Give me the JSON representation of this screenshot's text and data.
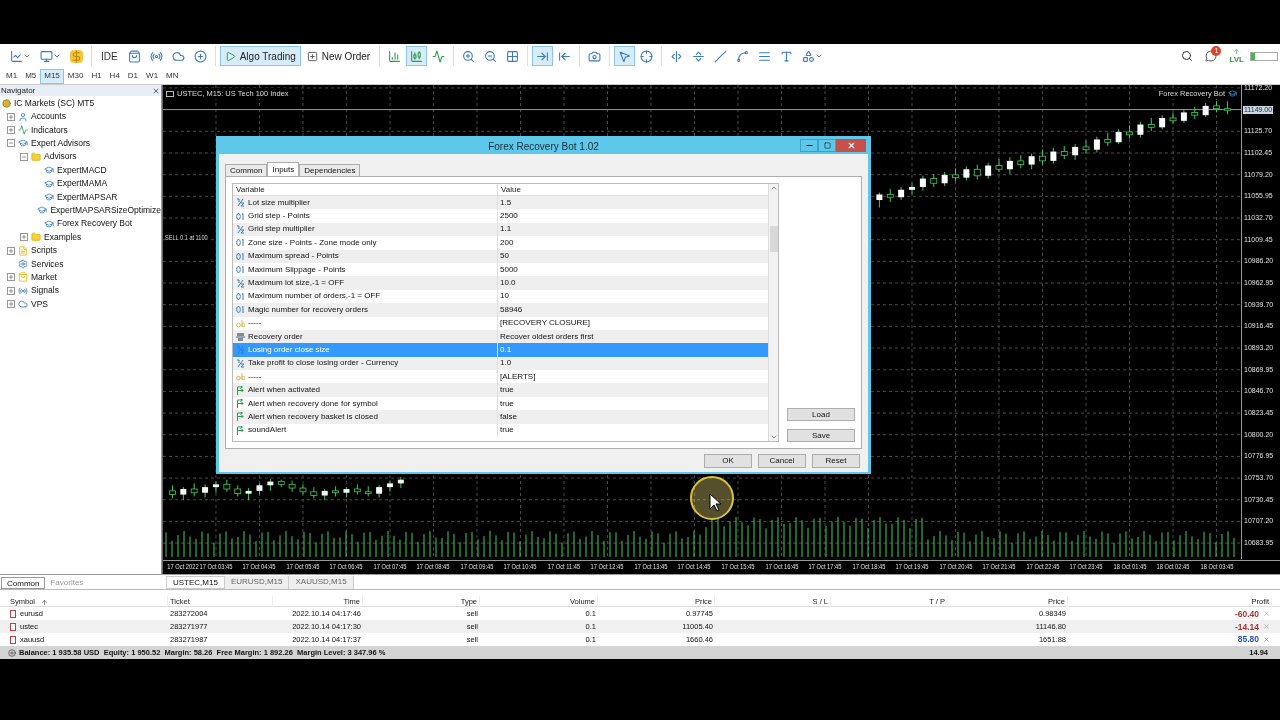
{
  "toolbar": {
    "groups": [
      [
        {
          "kind": "line-chart",
          "selected": false
        },
        {
          "kind": "chart-window",
          "selected": false
        },
        {
          "kind": "dollar",
          "selected": false
        }
      ],
      [
        {
          "kind": "ide",
          "label": "IDE",
          "selected": false
        },
        {
          "kind": "bag",
          "selected": false
        },
        {
          "kind": "signal",
          "selected": false
        },
        {
          "kind": "cloud",
          "selected": false
        },
        {
          "kind": "globe",
          "selected": false
        }
      ],
      [
        {
          "kind": "algo",
          "label": "Algo Trading",
          "selected": true
        },
        {
          "kind": "order",
          "label": "New Order",
          "selected": false
        }
      ],
      [
        {
          "kind": "bars",
          "selected": false
        },
        {
          "kind": "candles",
          "selected": true
        },
        {
          "kind": "line",
          "selected": false
        }
      ],
      [
        {
          "kind": "zoom-in",
          "selected": false
        },
        {
          "kind": "zoom-out",
          "selected": false
        },
        {
          "kind": "grid",
          "selected": false
        }
      ],
      [
        {
          "kind": "autoscroll",
          "selected": true
        },
        {
          "kind": "shift",
          "selected": false
        }
      ],
      [
        {
          "kind": "screenshot",
          "selected": false
        }
      ],
      [
        {
          "kind": "cursor",
          "selected": true
        },
        {
          "kind": "crosshair",
          "selected": false
        }
      ],
      [
        {
          "kind": "vline",
          "selected": false
        },
        {
          "kind": "hline",
          "selected": false
        },
        {
          "kind": "trendline",
          "selected": false
        },
        {
          "kind": "channel",
          "selected": false
        },
        {
          "kind": "fibo",
          "selected": false
        },
        {
          "kind": "text",
          "selected": false
        },
        {
          "kind": "shapes",
          "selected": false
        }
      ]
    ],
    "notifications": "1",
    "level_label": "LVL",
    "timeframes": [
      {
        "label": "M1",
        "selected": false
      },
      {
        "label": "M5",
        "selected": false
      },
      {
        "label": "M15",
        "selected": true
      },
      {
        "label": "M30",
        "selected": false
      },
      {
        "label": "H1",
        "selected": false
      },
      {
        "label": "H4",
        "selected": false
      },
      {
        "label": "D1",
        "selected": false
      },
      {
        "label": "W1",
        "selected": false
      },
      {
        "label": "MN",
        "selected": false
      }
    ]
  },
  "navigator": {
    "title": "Navigator",
    "root": {
      "label": "IC Markets (SC) MT5",
      "children": [
        {
          "label": "Accounts",
          "kind": "accounts",
          "expanded": false
        },
        {
          "label": "Indicators",
          "kind": "indicators",
          "expanded": false
        },
        {
          "label": "Expert Advisors",
          "kind": "experts",
          "expanded": true,
          "children": [
            {
              "label": "Advisors",
              "kind": "folder",
              "expanded": true,
              "children": [
                {
                  "label": "ExpertMACD",
                  "kind": "expert"
                },
                {
                  "label": "ExpertMAMA",
                  "kind": "expert"
                },
                {
                  "label": "ExpertMAPSAR",
                  "kind": "expert"
                },
                {
                  "label": "ExpertMAPSARSizeOptimize",
                  "kind": "expert"
                },
                {
                  "label": "Forex Recovery Bot",
                  "kind": "expert"
                }
              ]
            },
            {
              "label": "Examples",
              "kind": "folder",
              "expanded": false
            }
          ]
        },
        {
          "label": "Scripts",
          "kind": "scripts",
          "expanded": false
        },
        {
          "label": "Services",
          "kind": "services"
        },
        {
          "label": "Market",
          "kind": "market",
          "expanded": false
        },
        {
          "label": "Signals",
          "kind": "signals",
          "expanded": false
        },
        {
          "label": "VPS",
          "kind": "vps",
          "expanded": false
        }
      ]
    }
  },
  "chart": {
    "chart_data": {
      "type": "candlestick",
      "ylim": [
        10666.9,
        11175.4
      ],
      "grid": true,
      "ref_lines": [
        {
          "axis": "y",
          "value": 11149
        }
      ],
      "categories": [
        null,
        "17 Oct 2022",
        null,
        null,
        "17 Oct 03:45",
        null,
        null,
        null,
        "17 Oct 04:45",
        null,
        null,
        null,
        "17 Oct 05:45",
        null,
        null,
        null,
        "17 Oct 06:45",
        null,
        null,
        null,
        "17 Oct 07:45",
        null,
        null,
        null,
        "17 Oct 08:45",
        null,
        null,
        null,
        "17 Oct 09:45",
        null,
        null,
        null,
        "17 Oct 10:45",
        null,
        null,
        null,
        "17 Oct 11:45",
        null,
        null,
        null,
        "17 Oct 12:45",
        null,
        null,
        null,
        "17 Oct 13:45",
        null,
        null,
        null,
        "17 Oct 14:45",
        null,
        null,
        null,
        "17 Oct 15:45",
        null,
        null,
        null,
        "17 Oct 16:45",
        null,
        null,
        null,
        "17 Oct 17:45",
        null,
        null,
        null,
        "17 Oct 18:45",
        null,
        null,
        null,
        "17 Oct 19:45",
        null,
        null,
        null,
        "17 Oct 20:45",
        null,
        null,
        null,
        "17 Oct 21:45",
        null,
        null,
        null,
        "17 Oct 22:45",
        null,
        null,
        null,
        "17 Oct 23:45",
        null,
        null,
        null,
        "18 Oct 01:45",
        null,
        null,
        null,
        "18 Oct 02:45",
        null,
        null,
        null,
        "18 Oct 03:45",
        null
      ],
      "yticks": [
        {
          "value": 11172.2,
          "label": "11172.20"
        },
        {
          "value": 11125.7,
          "label": "11125.70"
        },
        {
          "value": 11102.45,
          "label": "11102.45"
        },
        {
          "value": 11079.2,
          "label": "11079.20"
        },
        {
          "value": 11055.95,
          "label": "11055.95"
        },
        {
          "value": 11032.7,
          "label": "11032.70"
        },
        {
          "value": 11009.45,
          "label": "11009.45"
        },
        {
          "value": 10986.2,
          "label": "10986.20"
        },
        {
          "value": 10962.95,
          "label": "10962.95"
        },
        {
          "value": 10939.7,
          "label": "10939.70"
        },
        {
          "value": 10916.45,
          "label": "10916.45"
        },
        {
          "value": 10893.2,
          "label": "10893.20"
        },
        {
          "value": 10869.95,
          "label": "10869.95"
        },
        {
          "value": 10846.7,
          "label": "10846.70"
        },
        {
          "value": 10823.45,
          "label": "10823.45"
        },
        {
          "value": 10800.2,
          "label": "10800.20"
        },
        {
          "value": 10776.95,
          "label": "10776.95"
        },
        {
          "value": 10753.7,
          "label": "10753.70"
        },
        {
          "value": 10730.45,
          "label": "10730.45"
        },
        {
          "value": 10707.2,
          "label": "10707.20"
        },
        {
          "value": 10683.95,
          "label": "10683.95"
        }
      ],
      "ohlc": [
        [
          10740,
          10746,
          10732,
          10736
        ],
        [
          10736,
          10744,
          10730,
          10742
        ],
        [
          10742,
          10748,
          10734,
          10738
        ],
        [
          10738,
          10747,
          10733,
          10744
        ],
        [
          10744,
          10750,
          10738,
          10747
        ],
        [
          10747,
          10752,
          10739,
          10742
        ],
        [
          10742,
          10746,
          10734,
          10737
        ],
        [
          10737,
          10743,
          10730,
          10740
        ],
        [
          10740,
          10748,
          10736,
          10746
        ],
        [
          10746,
          10753,
          10740,
          10750
        ],
        [
          10750,
          10752,
          10744,
          10747
        ],
        [
          10747,
          10751,
          10739,
          10743
        ],
        [
          10743,
          10747,
          10736,
          10739
        ],
        [
          10739,
          10744,
          10732,
          10735
        ],
        [
          10735,
          10742,
          10730,
          10740
        ],
        [
          10740,
          10745,
          10734,
          10738
        ],
        [
          10738,
          10744,
          10733,
          10742
        ],
        [
          10742,
          10747,
          10736,
          10739
        ],
        [
          10739,
          10745,
          10734,
          10737
        ],
        [
          10737,
          10746,
          10733,
          10744
        ],
        [
          10744,
          10751,
          10739,
          10748
        ],
        [
          10748,
          10755,
          10743,
          10752
        ],
        null,
        null,
        null,
        null,
        null,
        null,
        null,
        null,
        null,
        null,
        null,
        null,
        null,
        null,
        null,
        null,
        null,
        null,
        null,
        null,
        null,
        null,
        null,
        null,
        null,
        null,
        null,
        null,
        null,
        null,
        null,
        null,
        null,
        null,
        null,
        null,
        null,
        null,
        null,
        null,
        null,
        null,
        null,
        [
          11052,
          11060,
          11044,
          11058
        ],
        [
          11058,
          11064,
          11050,
          11055
        ],
        [
          11055,
          11066,
          11052,
          11063
        ],
        [
          11063,
          11070,
          11058,
          11066
        ],
        [
          11066,
          11078,
          11062,
          11075
        ],
        [
          11075,
          11080,
          11066,
          11070
        ],
        [
          11070,
          11082,
          11067,
          11079
        ],
        [
          11079,
          11086,
          11072,
          11076
        ],
        [
          11076,
          11088,
          11073,
          11085
        ],
        [
          11085,
          11090,
          11074,
          11078
        ],
        [
          11078,
          11092,
          11075,
          11089
        ],
        [
          11089,
          11096,
          11082,
          11085
        ],
        [
          11085,
          11098,
          11080,
          11094
        ],
        [
          11094,
          11100,
          11086,
          11090
        ],
        [
          11090,
          11102,
          11085,
          11099
        ],
        [
          11099,
          11106,
          11090,
          11094
        ],
        [
          11094,
          11108,
          11091,
          11104
        ],
        [
          11104,
          11110,
          11096,
          11100
        ],
        [
          11100,
          11112,
          11095,
          11109
        ],
        [
          11109,
          11116,
          11102,
          11106
        ],
        [
          11106,
          11120,
          11103,
          11117
        ],
        [
          11117,
          11124,
          11110,
          11114
        ],
        [
          11114,
          11128,
          11112,
          11125
        ],
        [
          11125,
          11132,
          11118,
          11122
        ],
        [
          11122,
          11136,
          11119,
          11133
        ],
        [
          11133,
          11140,
          11126,
          11130
        ],
        [
          11130,
          11143,
          11128,
          11140
        ],
        [
          11140,
          11146,
          11134,
          11137
        ],
        [
          11137,
          11149,
          11135,
          11146
        ],
        [
          11146,
          11152,
          11139,
          11143
        ],
        [
          11143,
          11156,
          11141,
          11153
        ],
        [
          11153,
          11158,
          11146,
          11150
        ],
        [
          11150,
          11158,
          11144,
          11149
        ]
      ]
    },
    "title": "USTEC, M15: US Tech 100 Index",
    "expert": "Forex Recovery Bot",
    "trade_label": "SELL 0.1 at 1100",
    "current_price": "11149.00",
    "expert_attached": true
  },
  "dialog": {
    "title": "Forex Recovery Bot 1.02",
    "tabs": [
      {
        "label": "Common",
        "selected": false
      },
      {
        "label": "Inputs",
        "selected": true
      },
      {
        "label": "Dependencies",
        "selected": false
      }
    ],
    "columns": [
      "Variable",
      "Value"
    ],
    "rows": [
      {
        "variable": "Lot size multiplier",
        "value": "1.5",
        "kind": "double",
        "selected": false
      },
      {
        "variable": "Grid step - Points",
        "value": "2500",
        "kind": "int",
        "selected": false
      },
      {
        "variable": "Grid step multiplier",
        "value": "1.1",
        "kind": "double",
        "selected": false
      },
      {
        "variable": "Zone size - Points - Zone mode only",
        "value": "200",
        "kind": "int",
        "selected": false
      },
      {
        "variable": "Maximum spread - Points",
        "value": "50",
        "kind": "int",
        "selected": false
      },
      {
        "variable": "Maximum Slippage - Points",
        "value": "5000",
        "kind": "int",
        "selected": false
      },
      {
        "variable": "Maximum lot size,-1 = OFF",
        "value": "10.0",
        "kind": "double",
        "selected": false
      },
      {
        "variable": "Maximum number of orders,-1 = OFF",
        "value": "10",
        "kind": "int",
        "selected": false
      },
      {
        "variable": "Magic number for recovery orders",
        "value": "58946",
        "kind": "int",
        "selected": false
      },
      {
        "variable": "-----",
        "value": "[RECOVERY CLOSURE]",
        "kind": "string",
        "selected": false
      },
      {
        "variable": "Recovery order",
        "value": "Recover oldest orders first",
        "kind": "enum",
        "selected": false
      },
      {
        "variable": "Losing order close size",
        "value": "0.1",
        "kind": "double",
        "selected": true
      },
      {
        "variable": "Take profit to close losing order - Currency",
        "value": "1.0",
        "kind": "double",
        "selected": false
      },
      {
        "variable": "-----",
        "value": "[ALERTS]",
        "kind": "string",
        "selected": false
      },
      {
        "variable": "Alert when activated",
        "value": "true",
        "kind": "bool",
        "selected": false
      },
      {
        "variable": "Alert when recovery done for symbol",
        "value": "true",
        "kind": "bool",
        "selected": false
      },
      {
        "variable": "Alert when recovery basket is closed",
        "value": "false",
        "kind": "bool",
        "selected": false
      },
      {
        "variable": "soundAlert",
        "value": "true",
        "kind": "bool",
        "selected": false
      }
    ],
    "side_buttons": [
      "Load",
      "Save"
    ],
    "buttons": [
      "OK",
      "Cancel",
      "Reset"
    ]
  },
  "bottom": {
    "panel_tabs": [
      {
        "label": "Common",
        "selected": true
      },
      {
        "label": "Favorites",
        "selected": false
      }
    ],
    "chart_tabs": [
      {
        "label": "USTEC,M15",
        "selected": true
      },
      {
        "label": "EURUSD,M15",
        "selected": false
      },
      {
        "label": "XAUUSD,M15",
        "selected": false
      }
    ],
    "columns": [
      {
        "label": "Symbol",
        "sorted": true
      },
      {
        "label": "Ticket",
        "sorted": false
      },
      {
        "label": "Time",
        "sorted": false
      },
      {
        "label": "Type",
        "sorted": false
      },
      {
        "label": "Volume",
        "sorted": false
      },
      {
        "label": "Price",
        "sorted": false
      },
      {
        "label": "S / L",
        "sorted": false
      },
      {
        "label": "T / P",
        "sorted": false
      },
      {
        "label": "Price",
        "sorted": false
      },
      {
        "label": "Profit",
        "sorted": false
      }
    ],
    "rows": [
      {
        "cells": [
          "eurusd",
          "283272004",
          "2022.10.14 04:17:46",
          "sell",
          "0.1",
          "0.97745",
          "",
          "",
          "0.98349",
          "-60.40"
        ],
        "color": "#b03030"
      },
      {
        "cells": [
          "ustec",
          "283271977",
          "2022.10.14 04:17:30",
          "sell",
          "0.1",
          "11005.40",
          "",
          "",
          "11146.80",
          "-14.14"
        ],
        "color": "#b03030"
      },
      {
        "cells": [
          "xauusd",
          "283271987",
          "2022.10.14 04:17:37",
          "sell",
          "0.1",
          "1660.46",
          "",
          "",
          "1651.88",
          "85.80"
        ],
        "color": "#2a50b0"
      }
    ],
    "summary": "Balance: 1 935.58 USD  Equity: 1 950.52  Margin: 58.26  Free Margin: 1 892.26  Margin Level: 3 347.96 %",
    "total": "14.94"
  }
}
